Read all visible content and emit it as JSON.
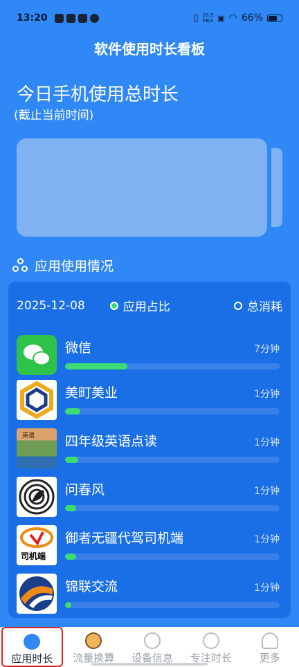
{
  "status_bar": {
    "time": "13:20",
    "net_speed_top": "10.9",
    "net_speed_bottom": "KB/s",
    "battery": "66%"
  },
  "header": {
    "title": "软件使用时长看板"
  },
  "today": {
    "title": "今日手机使用总时长",
    "subtitle": "(截止当前时间)"
  },
  "section": {
    "title": "应用使用情况",
    "icon": "recycle-share-icon"
  },
  "card": {
    "date": "2025-12-08",
    "legend_app_share": "应用占比",
    "legend_total": "总消耗"
  },
  "apps": [
    {
      "name": "微信",
      "time": "7分钟",
      "share": 0.29,
      "icon": "wechat-icon"
    },
    {
      "name": "美町美业",
      "time": "1分钟",
      "share": 0.07,
      "icon": "meiting-icon"
    },
    {
      "name": "四年级英语点读",
      "time": "1分钟",
      "share": 0.06,
      "icon": "english-book-icon"
    },
    {
      "name": "问春风",
      "time": "1分钟",
      "share": 0.05,
      "icon": "wenchunfeng-icon"
    },
    {
      "name": "御者无疆代驾司机端",
      "time": "1分钟",
      "share": 0.05,
      "icon": "driver-icon"
    },
    {
      "name": "锦联交流",
      "time": "1分钟",
      "share": 0.03,
      "icon": "jinlian-icon"
    }
  ],
  "nav": [
    {
      "label": "应用时长",
      "icon": "droplet-icon",
      "active": true
    },
    {
      "label": "流量换算",
      "icon": "swap-icon",
      "active": false
    },
    {
      "label": "设备信息",
      "icon": "wrench-icon",
      "active": false
    },
    {
      "label": "专注时长",
      "icon": "clock-icon",
      "active": false
    },
    {
      "label": "更多",
      "icon": "person-icon",
      "active": false
    }
  ],
  "colors": {
    "background": "#2f88f5",
    "card": "#1b6fe6",
    "bar_fill": "#3ddb74",
    "highlight": "#e02121"
  }
}
